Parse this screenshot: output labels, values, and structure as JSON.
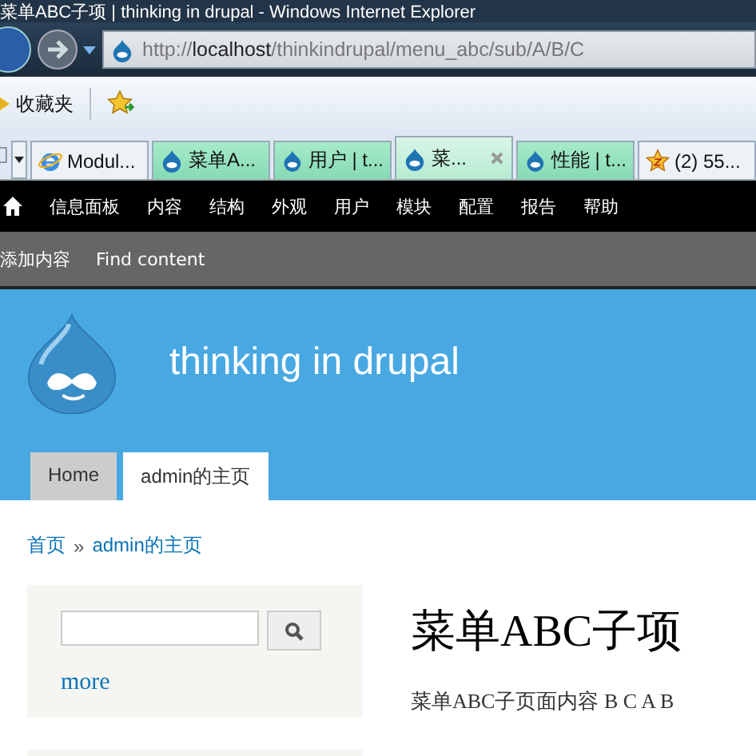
{
  "window": {
    "title": "菜单ABC子项 | thinking in drupal - Windows Internet Explorer"
  },
  "address_bar": {
    "url_prefix": "http://",
    "host": "localhost",
    "path": "/thinkindrupal/menu_abc/sub/A/B/C"
  },
  "favorites_bar": {
    "label": "收藏夹"
  },
  "browser_tabs": [
    {
      "label": "Modul...",
      "kind": "ie",
      "selected": false,
      "closable": false
    },
    {
      "label": "菜单A...",
      "kind": "drupal",
      "selected": false,
      "closable": false
    },
    {
      "label": "用户 | t...",
      "kind": "drupal",
      "selected": false,
      "closable": false
    },
    {
      "label": "菜...",
      "kind": "drupal",
      "selected": true,
      "closable": true
    },
    {
      "label": "性能 | t...",
      "kind": "drupal",
      "selected": false,
      "closable": false
    },
    {
      "label": "(2) 55...",
      "kind": "star",
      "selected": false,
      "closable": false
    }
  ],
  "admin_menu": [
    "信息面板",
    "内容",
    "结构",
    "外观",
    "用户",
    "模块",
    "配置",
    "报告",
    "帮助"
  ],
  "shortcuts": [
    "添加内容",
    "Find content"
  ],
  "site": {
    "name": "thinking in drupal"
  },
  "primary_tabs": [
    {
      "label": "Home",
      "selected": false
    },
    {
      "label": "admin的主页",
      "selected": true
    }
  ],
  "breadcrumb": [
    "首页",
    "admin的主页"
  ],
  "breadcrumb_separator": "»",
  "sidebar": {
    "more_link": "more"
  },
  "page": {
    "title": "菜单ABC子项",
    "body": "菜单ABC子页面内容 B C A B"
  }
}
